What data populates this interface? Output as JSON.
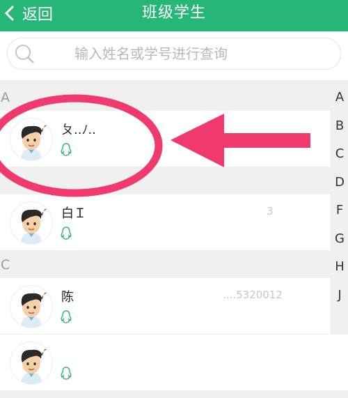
{
  "header": {
    "back_label": "返回",
    "title": "班级学生"
  },
  "search": {
    "placeholder": "输入姓名或学号进行查询"
  },
  "sections": [
    {
      "letter": "A"
    },
    {
      "letter": "C"
    }
  ],
  "students": [
    {
      "name": "ㄆ..ﾉ..",
      "number": ""
    },
    {
      "name": "白Ｉ",
      "number": "3"
    },
    {
      "name": "陈",
      "number": "....5320012"
    },
    {
      "name": "",
      "number": ""
    }
  ],
  "index_letters": [
    "A",
    "B",
    "C",
    "D",
    "F",
    "G",
    "H",
    "J"
  ],
  "icons": {
    "back": "chevron-left-icon",
    "search": "search-icon",
    "avatar": "student-avatar-icon",
    "qq": "qq-icon"
  },
  "colors": {
    "header": "#26b677",
    "annotation": "#f0396c",
    "qq_icon": "#34b26e"
  }
}
